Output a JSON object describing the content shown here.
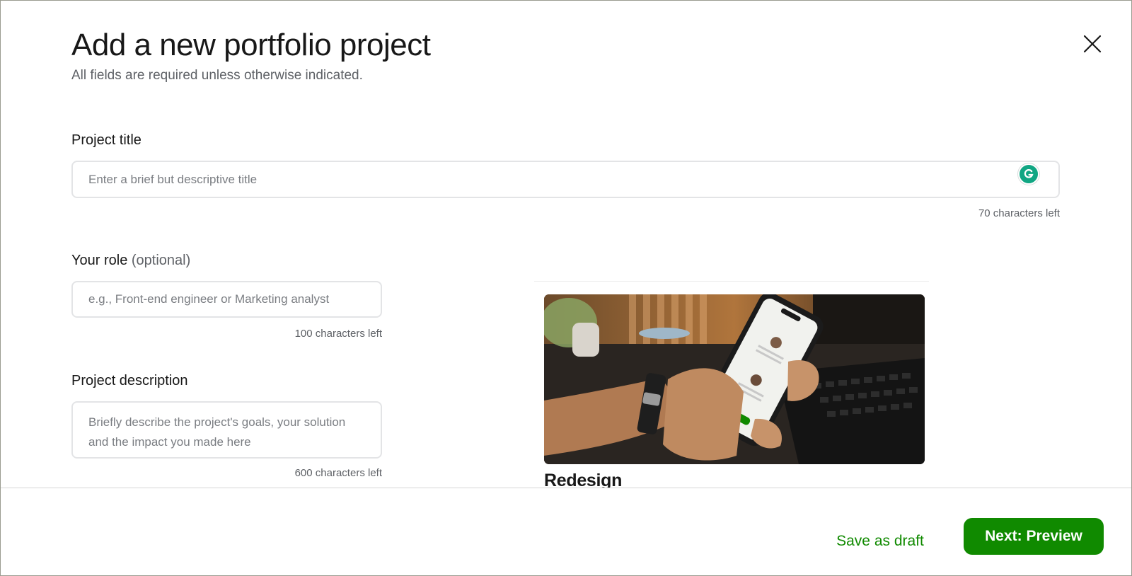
{
  "modal": {
    "title": "Add a new portfolio project",
    "subtitle": "All fields are required unless otherwise indicated."
  },
  "icons": {
    "close": "close-icon",
    "grammarly": "grammarly-icon"
  },
  "form": {
    "project_title": {
      "label": "Project title",
      "placeholder": "Enter a brief but descriptive title",
      "counter": "70 characters left"
    },
    "role": {
      "label": "Your role",
      "optional": "(optional)",
      "placeholder": "e.g., Front-end engineer or Marketing analyst",
      "counter": "100 characters left"
    },
    "description": {
      "label": "Project description",
      "placeholder": "Briefly describe the project's goals, your solution and the impact you made here",
      "counter": "600 characters left"
    }
  },
  "preview": {
    "title": "Redesign"
  },
  "footer": {
    "save_draft": "Save as draft",
    "next": "Next: Preview"
  },
  "colors": {
    "accent": "#108a00",
    "border": "#e3e4e6",
    "muted_text": "#5e6166"
  }
}
